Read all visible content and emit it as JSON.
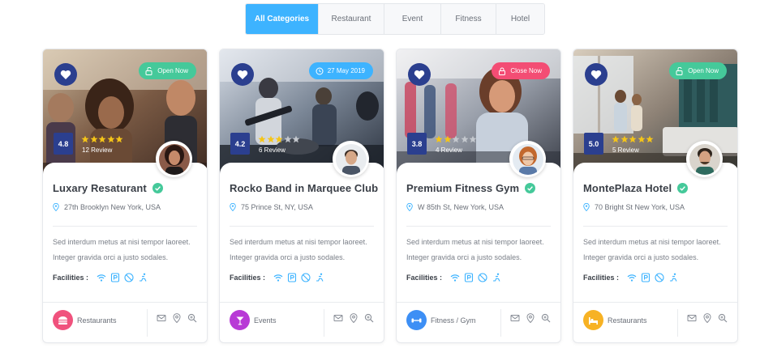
{
  "tabs": [
    {
      "label": "All Categories",
      "active": true
    },
    {
      "label": "Restaurant",
      "active": false
    },
    {
      "label": "Event",
      "active": false
    },
    {
      "label": "Fitness",
      "active": false
    },
    {
      "label": "Hotel",
      "active": false
    }
  ],
  "common": {
    "description": "Sed interdum metus at nisi tempor laoreet. Integer gravida orci a justo sodales.",
    "facilities_label": "Facilities :"
  },
  "cards": [
    {
      "badge": "Open Now",
      "badge_icon": "lock-open-icon",
      "rating": "4.8",
      "stars": 5,
      "review": "12 Review",
      "title": "Luxary Resaturant",
      "address": "27th Brooklyn New York, USA",
      "category": "Restaurants",
      "category_icon": "burger-icon",
      "colors": {
        "badge": "#45c99a",
        "category": "#f0527d"
      }
    },
    {
      "badge": "27 May 2019",
      "badge_icon": "clock-icon",
      "rating": "4.2",
      "stars": 3,
      "review": "6 Review",
      "title": "Rocko Band in Marquee Club",
      "address": "75 Prince St, NY, USA",
      "category": "Events",
      "category_icon": "cocktail-icon",
      "colors": {
        "badge": "#3db3ff",
        "category": "#b83ad6"
      }
    },
    {
      "badge": "Close Now",
      "badge_icon": "lock-icon",
      "rating": "3.8",
      "stars": 2,
      "review": "4 Review",
      "title": "Premium Fitness Gym",
      "address": "W 85th St, New York, USA",
      "category": "Fitness / Gym",
      "category_icon": "dumbbell-icon",
      "colors": {
        "badge": "#f34d74",
        "category": "#3d8ff5"
      }
    },
    {
      "badge": "Open Now",
      "badge_icon": "lock-open-icon",
      "rating": "5.0",
      "stars": 5,
      "review": "5 Review",
      "title": "MontePlaza Hotel",
      "address": "70 Bright St New York, USA",
      "category": "Restaurants",
      "category_icon": "bed-icon",
      "colors": {
        "badge": "#45c99a",
        "category": "#f7b224"
      }
    }
  ],
  "colors": {
    "accent": "#3db3ff",
    "navy": "#2b3f8f",
    "star": "#f5c518",
    "verified": "#45c99a",
    "facility": "#3db3ff"
  }
}
